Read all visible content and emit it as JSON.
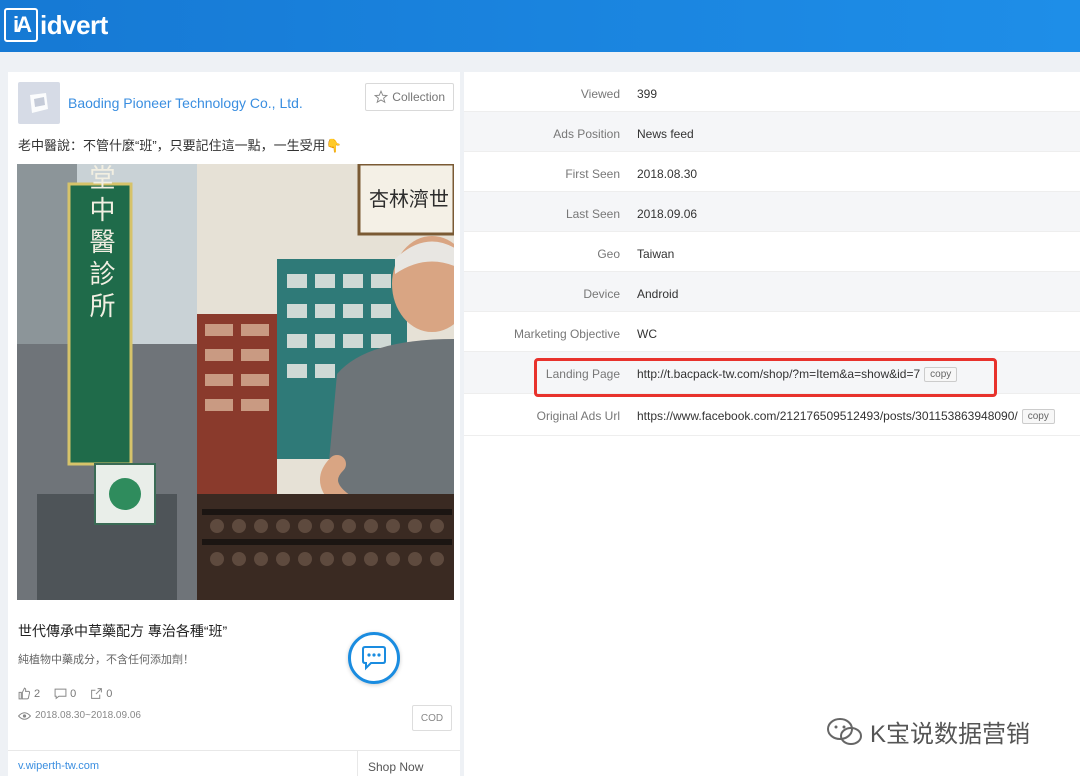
{
  "header": {
    "logo_mark": "iA",
    "logo_text": "idvert",
    "bg_color": "#1a85de"
  },
  "ad": {
    "advertiser": "Baoding Pioneer Technology Co., Ltd.",
    "collection_label": "Collection",
    "collection_icon": "star-outline-icon",
    "text": "老中醫說：不管什麼“班”，只要記住這一點，一生受用👇",
    "headline": "世代傳承中草藥配方 專治各種“班”",
    "description": "純植物中藥成分，不含任何添加劑！",
    "likes": "2",
    "comments": "0",
    "shares": "0",
    "date_range": "2018.08.30~2018.09.06",
    "cod_label": "COD",
    "link": "v.wiperth-tw.com",
    "cta": "Shop Now",
    "image_signs": {
      "vertical_sign": "仁德堂中醫診所",
      "top_sign": "杏林濟世"
    }
  },
  "details": {
    "rows": [
      {
        "label": "Viewed",
        "value": "399"
      },
      {
        "label": "Ads Position",
        "value": "News feed"
      },
      {
        "label": "First Seen",
        "value": "2018.08.30"
      },
      {
        "label": "Last Seen",
        "value": "2018.09.06"
      },
      {
        "label": "Geo",
        "value": "Taiwan"
      },
      {
        "label": "Device",
        "value": "Android"
      },
      {
        "label": "Marketing Objective",
        "value": "WC"
      },
      {
        "label": "Landing Page",
        "value": "http://t.bacpack-tw.com/shop/?m=Item&a=show&id=7",
        "copy": "copy"
      },
      {
        "label": "Original Ads Url",
        "value": "https://www.facebook.com/212176509512493/posts/301153863948090/",
        "copy": "copy"
      }
    ],
    "highlight_color": "#e8322c"
  },
  "watermark": {
    "text": "K宝说数据营销"
  }
}
